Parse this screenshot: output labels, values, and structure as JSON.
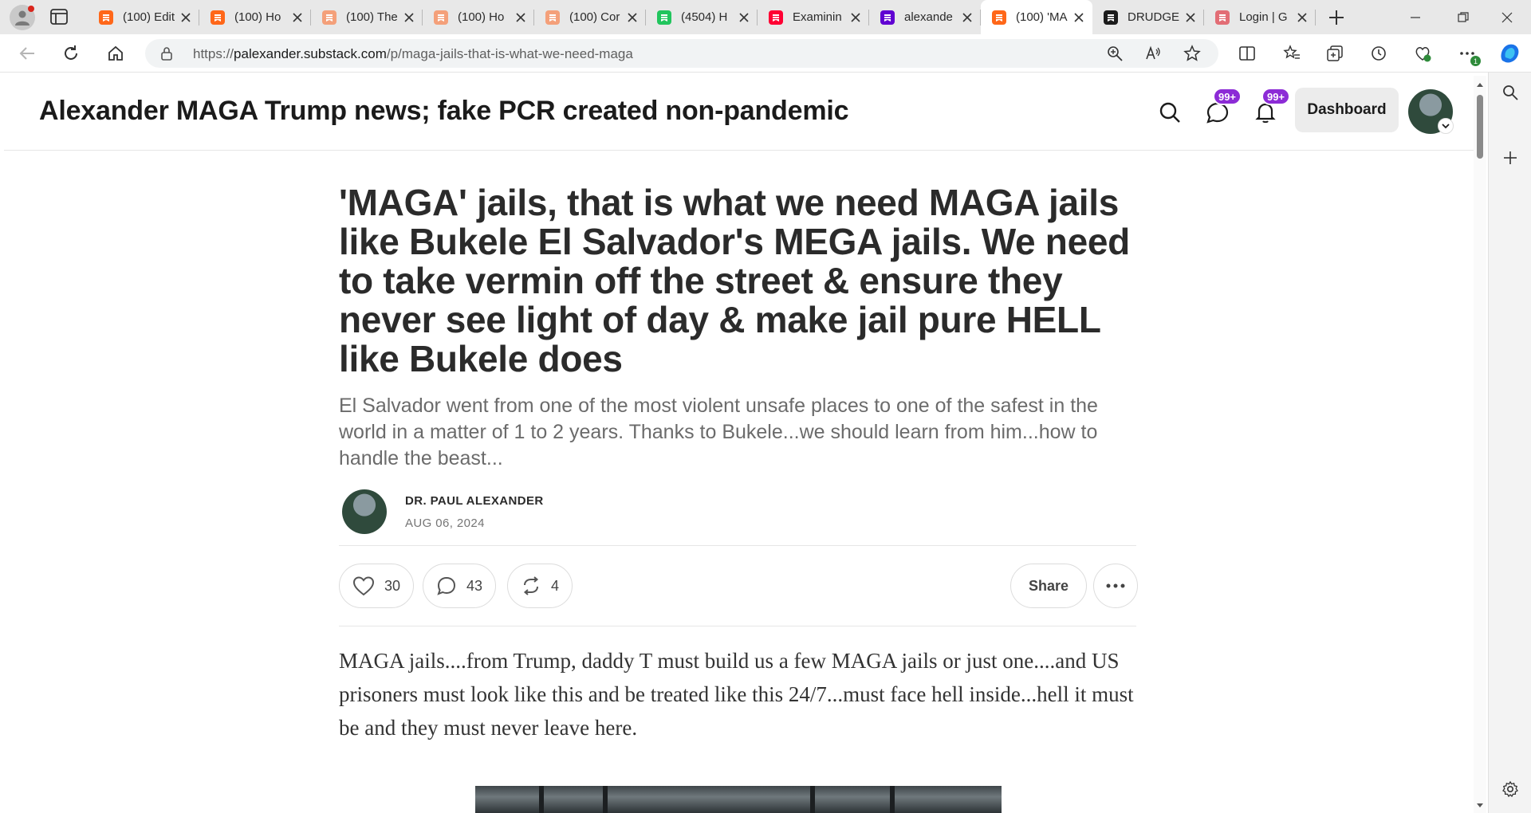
{
  "browser": {
    "tabs": [
      {
        "title": "(100) Edit",
        "favicon": "substack-icon",
        "color": "#ff6719"
      },
      {
        "title": "(100) Ho",
        "favicon": "substack-icon",
        "color": "#ff6719"
      },
      {
        "title": "(100) The",
        "favicon": "substack-icon",
        "color": "#f4a07a"
      },
      {
        "title": "(100) Ho",
        "favicon": "substack-icon",
        "color": "#f4a07a"
      },
      {
        "title": "(100) Cor",
        "favicon": "substack-icon",
        "color": "#f4a07a"
      },
      {
        "title": "(4504) H",
        "favicon": "gab-icon",
        "color": "#21c55d"
      },
      {
        "title": "Examinin",
        "favicon": "youtube-icon",
        "color": "#ff0033"
      },
      {
        "title": "alexande",
        "favicon": "yahoo-icon",
        "color": "#6001d2"
      },
      {
        "title": "(100) 'MA",
        "favicon": "substack-icon",
        "color": "#ff6719"
      },
      {
        "title": "DRUDGE",
        "favicon": "drudge-icon",
        "color": "#1b1b1b"
      },
      {
        "title": "Login | G",
        "favicon": "gettr-icon",
        "color": "#e26d75"
      }
    ],
    "active_tab_index": 8,
    "url_prefix": "https://",
    "url_host": "palexander.substack.com",
    "url_path": "/p/maga-jails-that-is-what-we-need-maga",
    "extension_badge": "1"
  },
  "header": {
    "publication_title": "Alexander MAGA Trump news; fake PCR created non-pandemic",
    "chat_badge": "99+",
    "notifications_badge": "99+",
    "dashboard_label": "Dashboard",
    "accent_color": "#8c2bd6"
  },
  "post": {
    "title": "'MAGA' jails, that is what we need MAGA jails like Bukele El Salvador's MEGA jails. We need to take vermin off the street & ensure they never see light of day & make jail pure HELL like Bukele does",
    "subtitle": "El Salvador went from one of the most violent unsafe places to one of the safest in the world in a matter of 1 to 2 years. Thanks to Bukele...we should learn from him...how to handle the beast...",
    "author": "DR. PAUL ALEXANDER",
    "date": "AUG 06, 2024",
    "likes": "30",
    "comments": "43",
    "restacks": "4",
    "share_label": "Share",
    "body": "MAGA jails....from Trump, daddy T must build us a few MAGA jails or just one....and US prisoners must look like this and be treated like this 24/7...must face hell inside...hell it must be and they must never leave here."
  }
}
